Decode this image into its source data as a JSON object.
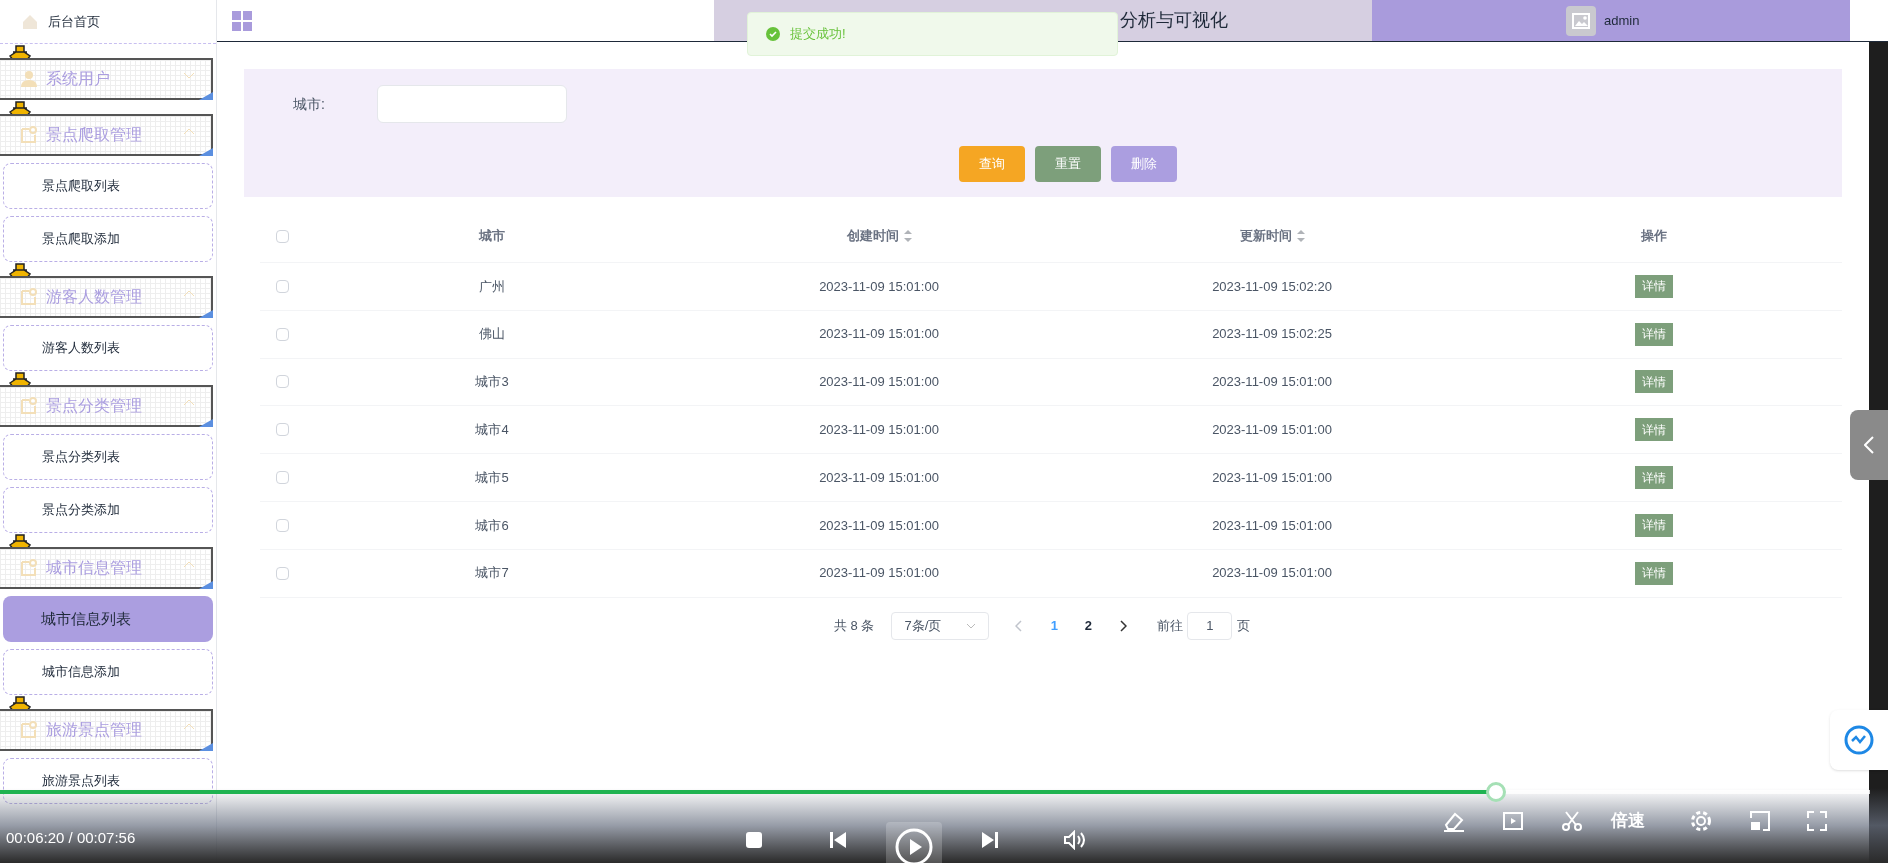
{
  "sidebar": {
    "home": {
      "label": "后台首页"
    },
    "groups": [
      {
        "label": "系统用户",
        "expanded": false
      },
      {
        "label": "景点爬取管理",
        "expanded": true,
        "items": [
          {
            "label": "景点爬取列表",
            "selected": false
          },
          {
            "label": "景点爬取添加",
            "selected": false
          }
        ]
      },
      {
        "label": "游客人数管理",
        "expanded": true,
        "items": [
          {
            "label": "游客人数列表",
            "selected": false
          }
        ]
      },
      {
        "label": "景点分类管理",
        "expanded": true,
        "items": [
          {
            "label": "景点分类列表",
            "selected": false
          },
          {
            "label": "景点分类添加",
            "selected": false
          }
        ]
      },
      {
        "label": "城市信息管理",
        "expanded": true,
        "items": [
          {
            "label": "城市信息列表",
            "selected": true
          },
          {
            "label": "城市信息添加",
            "selected": false
          }
        ]
      },
      {
        "label": "旅游景点管理",
        "expanded": true,
        "items": [
          {
            "label": "旅游景点列表",
            "selected": false
          }
        ]
      }
    ]
  },
  "header": {
    "title": "分析与可视化",
    "user": "admin"
  },
  "toast": {
    "message": "提交成功!"
  },
  "search": {
    "label": "城市:",
    "buttons": [
      {
        "label": "查询",
        "color": "#f5a623"
      },
      {
        "label": "重置",
        "color": "#7d9f7b"
      },
      {
        "label": "删除",
        "color": "#ab9ee0"
      }
    ]
  },
  "table": {
    "columns": [
      {
        "kind": "checkbox",
        "checked": false
      },
      {
        "kind": "text",
        "label": "城市",
        "sortable": false
      },
      {
        "kind": "text",
        "label": "创建时间",
        "sortable": true
      },
      {
        "kind": "text",
        "label": "更新时间",
        "sortable": true
      },
      {
        "kind": "text",
        "label": "操作",
        "sortable": false
      }
    ],
    "rows": [
      {
        "checked": false,
        "city": "广州",
        "created": "2023-11-09 15:01:00",
        "updated": "2023-11-09 15:02:20",
        "action": "详情"
      },
      {
        "checked": false,
        "city": "佛山",
        "created": "2023-11-09 15:01:00",
        "updated": "2023-11-09 15:02:25",
        "action": "详情"
      },
      {
        "checked": false,
        "city": "城市3",
        "created": "2023-11-09 15:01:00",
        "updated": "2023-11-09 15:01:00",
        "action": "详情"
      },
      {
        "checked": false,
        "city": "城市4",
        "created": "2023-11-09 15:01:00",
        "updated": "2023-11-09 15:01:00",
        "action": "详情"
      },
      {
        "checked": false,
        "city": "城市5",
        "created": "2023-11-09 15:01:00",
        "updated": "2023-11-09 15:01:00",
        "action": "详情"
      },
      {
        "checked": false,
        "city": "城市6",
        "created": "2023-11-09 15:01:00",
        "updated": "2023-11-09 15:01:00",
        "action": "详情"
      },
      {
        "checked": false,
        "city": "城市7",
        "created": "2023-11-09 15:01:00",
        "updated": "2023-11-09 15:01:00",
        "action": "详情"
      }
    ]
  },
  "pagination": {
    "total": "共 8 条",
    "page_size": "7条/页",
    "pages": [
      {
        "label": "1",
        "selected": true
      },
      {
        "label": "2",
        "selected": false
      }
    ],
    "goto_label": "前往",
    "goto_value": "1",
    "page_unit": "页"
  },
  "player": {
    "time": "00:06:20 / 00:07:56",
    "level": 0.8,
    "speed": "倍速"
  }
}
